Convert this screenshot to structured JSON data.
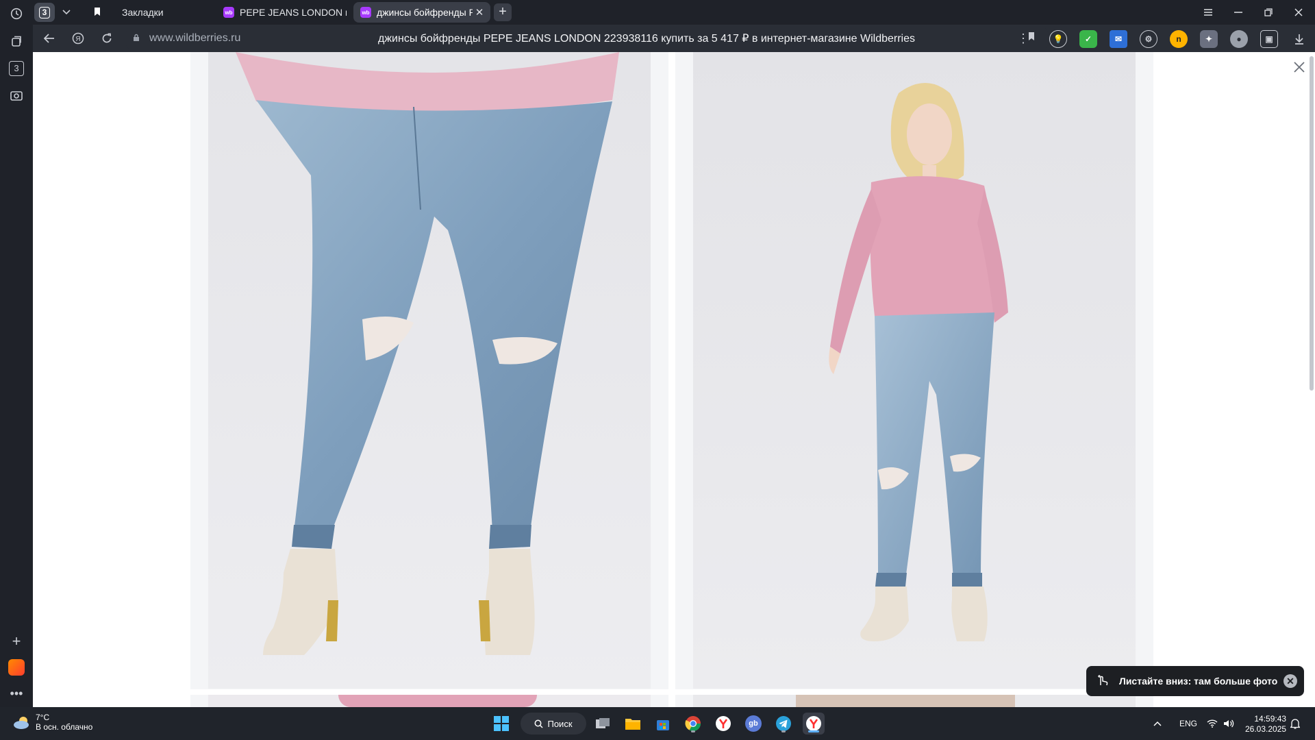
{
  "browser": {
    "tab_count": "3",
    "tabs": [
      {
        "label": "Закладки",
        "active": false
      },
      {
        "label": "PEPE JEANS LONDON вес",
        "active": false
      },
      {
        "label": "джинсы бойфренды PE",
        "active": true
      }
    ],
    "favicon_label": "wb",
    "address": {
      "host": "www.wildberries.ru",
      "title": "джинсы бойфренды PEPE JEANS LONDON 223938116 купить за 5 417 ₽ в интернет-магазине Wildberries"
    },
    "sidebar": {
      "tab_badge": "3"
    }
  },
  "viewer": {
    "toast_text": "Листайте вниз: там больше фото"
  },
  "taskbar": {
    "weather_temp": "7°C",
    "weather_desc": "В осн. облачно",
    "search_label": "Поиск",
    "language": "ENG",
    "time": "14:59:43",
    "date": "26.03.2025",
    "gb_label": "gb"
  },
  "colors": {
    "accent_wb": "#a73afd",
    "yandex_red": "#ff2f2f",
    "taskbar_bg": "#20242b",
    "toast_bg": "#1d1f23"
  },
  "icons": [
    "history-icon",
    "collections-icon",
    "tab-badge-icon",
    "screenshot-icon",
    "add-icon",
    "alice-pack-icon",
    "more-icon",
    "back-icon",
    "yandex-icon",
    "reload-icon",
    "lock-icon",
    "bookmark-icon",
    "menu-icon"
  ]
}
